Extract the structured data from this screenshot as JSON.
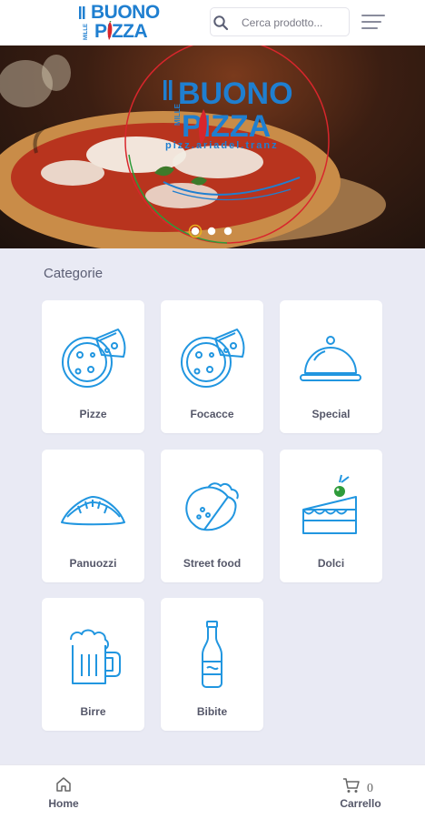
{
  "header": {
    "logo": {
      "line1": "BUONO",
      "line2": "PIZZA",
      "side": "MILLE"
    },
    "search": {
      "placeholder": "Cerca prodotto...",
      "value": ""
    }
  },
  "hero": {
    "logo": {
      "line1": "BUONO",
      "line2": "PIZZA",
      "side": "MILLE",
      "tagline": "pizz.ariadel.tranz"
    },
    "slide_count": 3,
    "active_slide": 1
  },
  "categories": {
    "title": "Categorie",
    "items": [
      {
        "label": "Pizze",
        "icon": "pizza-icon"
      },
      {
        "label": "Focacce",
        "icon": "pizza-icon"
      },
      {
        "label": "Special",
        "icon": "cloche-icon"
      },
      {
        "label": "Panuozzi",
        "icon": "calzone-icon"
      },
      {
        "label": "Street food",
        "icon": "taco-icon"
      },
      {
        "label": "Dolci",
        "icon": "cake-icon"
      },
      {
        "label": "Birre",
        "icon": "beer-icon"
      },
      {
        "label": "Bibite",
        "icon": "bottle-icon"
      }
    ]
  },
  "bottom_nav": {
    "home_label": "Home",
    "cart_label": "Carrello",
    "cart_count": "0"
  },
  "colors": {
    "brand_blue": "#1f7fd0",
    "icon_blue": "#2196e0",
    "background": "#e9eaf4",
    "text": "#555769",
    "pepper_red": "#d8262c"
  }
}
